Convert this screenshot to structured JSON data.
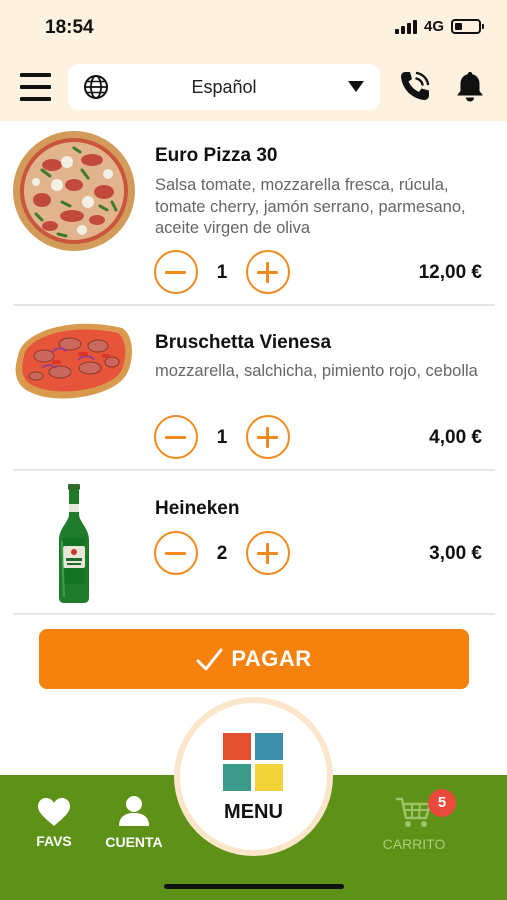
{
  "status_bar": {
    "time": "18:54",
    "network": "4G",
    "battery_level": 0.3
  },
  "header": {
    "menu_icon": "hamburger-icon",
    "language": {
      "icon": "globe-icon",
      "selected": "Español",
      "caret_icon": "caret-down-icon"
    },
    "call_icon": "phone-icon",
    "notifications_icon": "bell-icon"
  },
  "cart": {
    "items": [
      {
        "name": "Euro Pizza 30",
        "description": "Salsa tomate, mozzarella fresca, rúcula, tomate cherry, jamón serrano, parmesano, aceite virgen de oliva",
        "quantity": "1",
        "price": "12,00 €",
        "image": "pizza-image"
      },
      {
        "name": "Bruschetta Vienesa",
        "description": "mozzarella, salchicha, pimiento rojo, cebolla",
        "quantity": "1",
        "price": "4,00 €",
        "image": "bruschetta-image"
      },
      {
        "name": "Heineken",
        "description": "",
        "quantity": "2",
        "price": "3,00 €",
        "image": "beer-bottle-image"
      }
    ],
    "pay_button": {
      "label": "PAGAR",
      "icon": "checkmark-icon"
    }
  },
  "bottom_nav": {
    "favs": {
      "label": "FAVS",
      "icon": "heart-icon"
    },
    "account": {
      "label": "CUENTA",
      "icon": "user-icon"
    },
    "menu": {
      "label": "MENU",
      "icon": "menu-tiles-icon"
    },
    "cart": {
      "label": "CARRITO",
      "icon": "cart-icon",
      "badge": "5"
    }
  },
  "colors": {
    "accent_orange": "#f5810f",
    "nav_green": "#5e9117",
    "header_bg": "#fdf1e0",
    "badge_red": "#ea4a3b"
  }
}
